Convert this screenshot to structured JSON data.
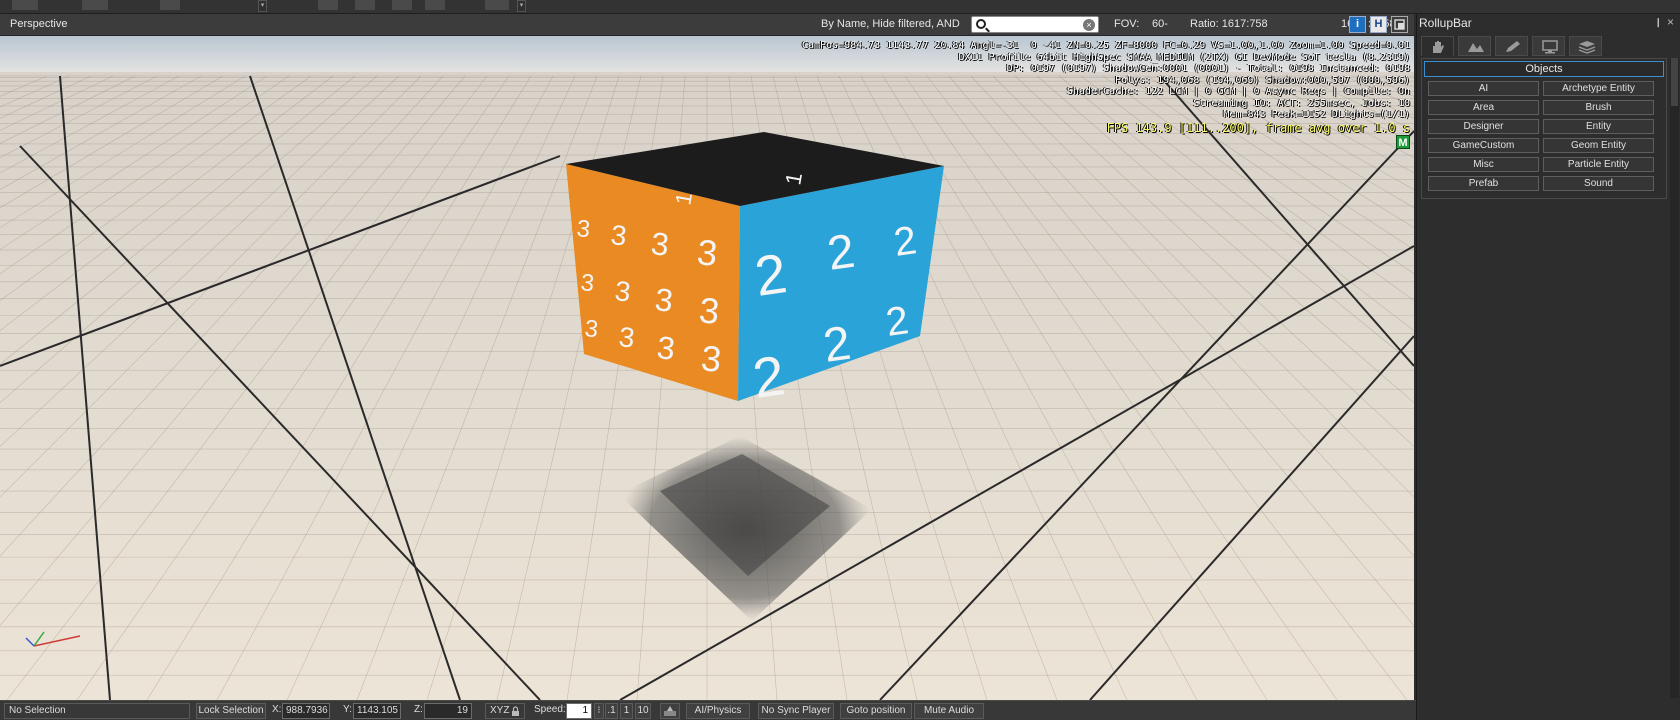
{
  "viewport_header": {
    "title": "Perspective",
    "filter_text": "By Name, Hide filtered, AND",
    "search_value": "",
    "fov_label": "FOV:",
    "fov_value": "60-",
    "ratio_label": "Ratio: 1617:758",
    "size_label": "1617 x 758",
    "info_button": "i",
    "h_button": "H"
  },
  "hud": {
    "line1": "CamPos=984.73 1143.77 20.84 Angl=-31  0 -41 ZN=0.25 ZF=8000 FC=0.29 VS=1.00,1.00 Zoom=1.00 Speed=0.01",
    "line2": "DX11 Profile 64bit HighSpec SMAA_MEDIUM (2TX) GI DevMode SoT tesla (8.2319)",
    "line3": "DP: 0197 (0197) ShadowGen:0001 (0001) - Total: 0198 Instanced: 0198",
    "line4": "Polys: 194,068 (194,069) Shadow:000,597 (000,596)",
    "line5": "ShaderCache: 122 LCM | 0 GCM | 0 Async Reqs | Compile: On",
    "line6": "Streaming IO: ACT: 255msec, Jobs: 10",
    "line7": "Mem=843 Peak=1152 DLights=(1/1)",
    "fps": "FPS 143.9 [111..200], frame avg over 1.0 s",
    "m_badge": "M"
  },
  "cube": {
    "top_label": "1",
    "left_label": "3",
    "right_label": "2",
    "left_color": "#e98a22",
    "right_color": "#2aa3d8",
    "top_color": "#1c1c1c"
  },
  "status_bar": {
    "selection": "No Selection",
    "lock_selection": "Lock Selection",
    "x_label": "X:",
    "x_value": "988.7936",
    "y_label": "Y:",
    "y_value": "1143.105",
    "z_label": "Z:",
    "z_value": "19",
    "xyz": "XYZ",
    "speed_label": "Speed:",
    "speed_value": "1",
    "speed_01": ".1",
    "speed_1": "1",
    "speed_10": "10",
    "ai_physics": "AI/Physics",
    "no_sync_player": "No Sync Player",
    "goto_position": "Goto position",
    "mute_audio": "Mute Audio"
  },
  "rollup": {
    "title": "RollupBar",
    "pin": "❙",
    "close": "×",
    "section": "Objects",
    "buttons": [
      "AI",
      "Archetype Entity",
      "Area",
      "Brush",
      "Designer",
      "Entity",
      "GameCustom",
      "Geom Entity",
      "Misc",
      "Particle Entity",
      "Prefab",
      "Sound"
    ]
  },
  "icons": {
    "tabs": [
      "hand-objects-icon",
      "terrain-icon",
      "brush-pencil-icon",
      "display-monitor-icon",
      "layers-icon"
    ],
    "search": "search-icon",
    "clear": "clear-search-icon",
    "lock": "lock-icon"
  }
}
